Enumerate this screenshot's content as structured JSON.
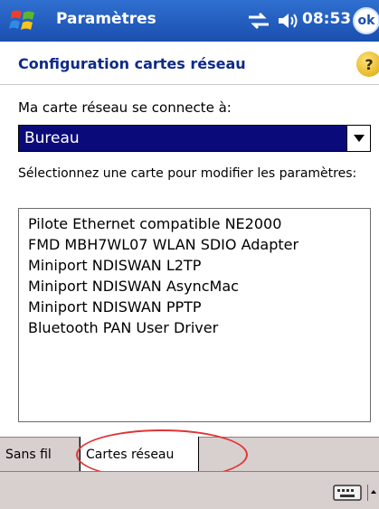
{
  "titlebar": {
    "app_title": "Paramètres",
    "clock": "08:53",
    "ok_label": "ok",
    "icons": [
      "windows-start-icon",
      "connectivity-icon",
      "volume-icon"
    ]
  },
  "header": {
    "title": "Configuration cartes réseau",
    "help_label": "?"
  },
  "form": {
    "connect_label": "Ma carte réseau se connecte à:",
    "connect_value": "Bureau",
    "instruction": "Sélectionnez une carte pour modifier les paramètres:"
  },
  "adapters": [
    "Pilote Ethernet compatible NE2000",
    "FMD MBH7WL07 WLAN SDIO Adapter",
    "Miniport NDISWAN L2TP",
    "Miniport NDISWAN AsyncMac",
    "Miniport NDISWAN PPTP",
    "Bluetooth PAN User Driver"
  ],
  "tabs": [
    {
      "label": "Sans fil",
      "selected": false
    },
    {
      "label": "Cartes réseau",
      "selected": true
    }
  ],
  "colors": {
    "titlebar": "#1a4fae",
    "title_text": "#0e2a8c",
    "selection": "#0a0a7a",
    "highlight_ring": "#e03434",
    "tab_bg": "#d8cfcf"
  }
}
